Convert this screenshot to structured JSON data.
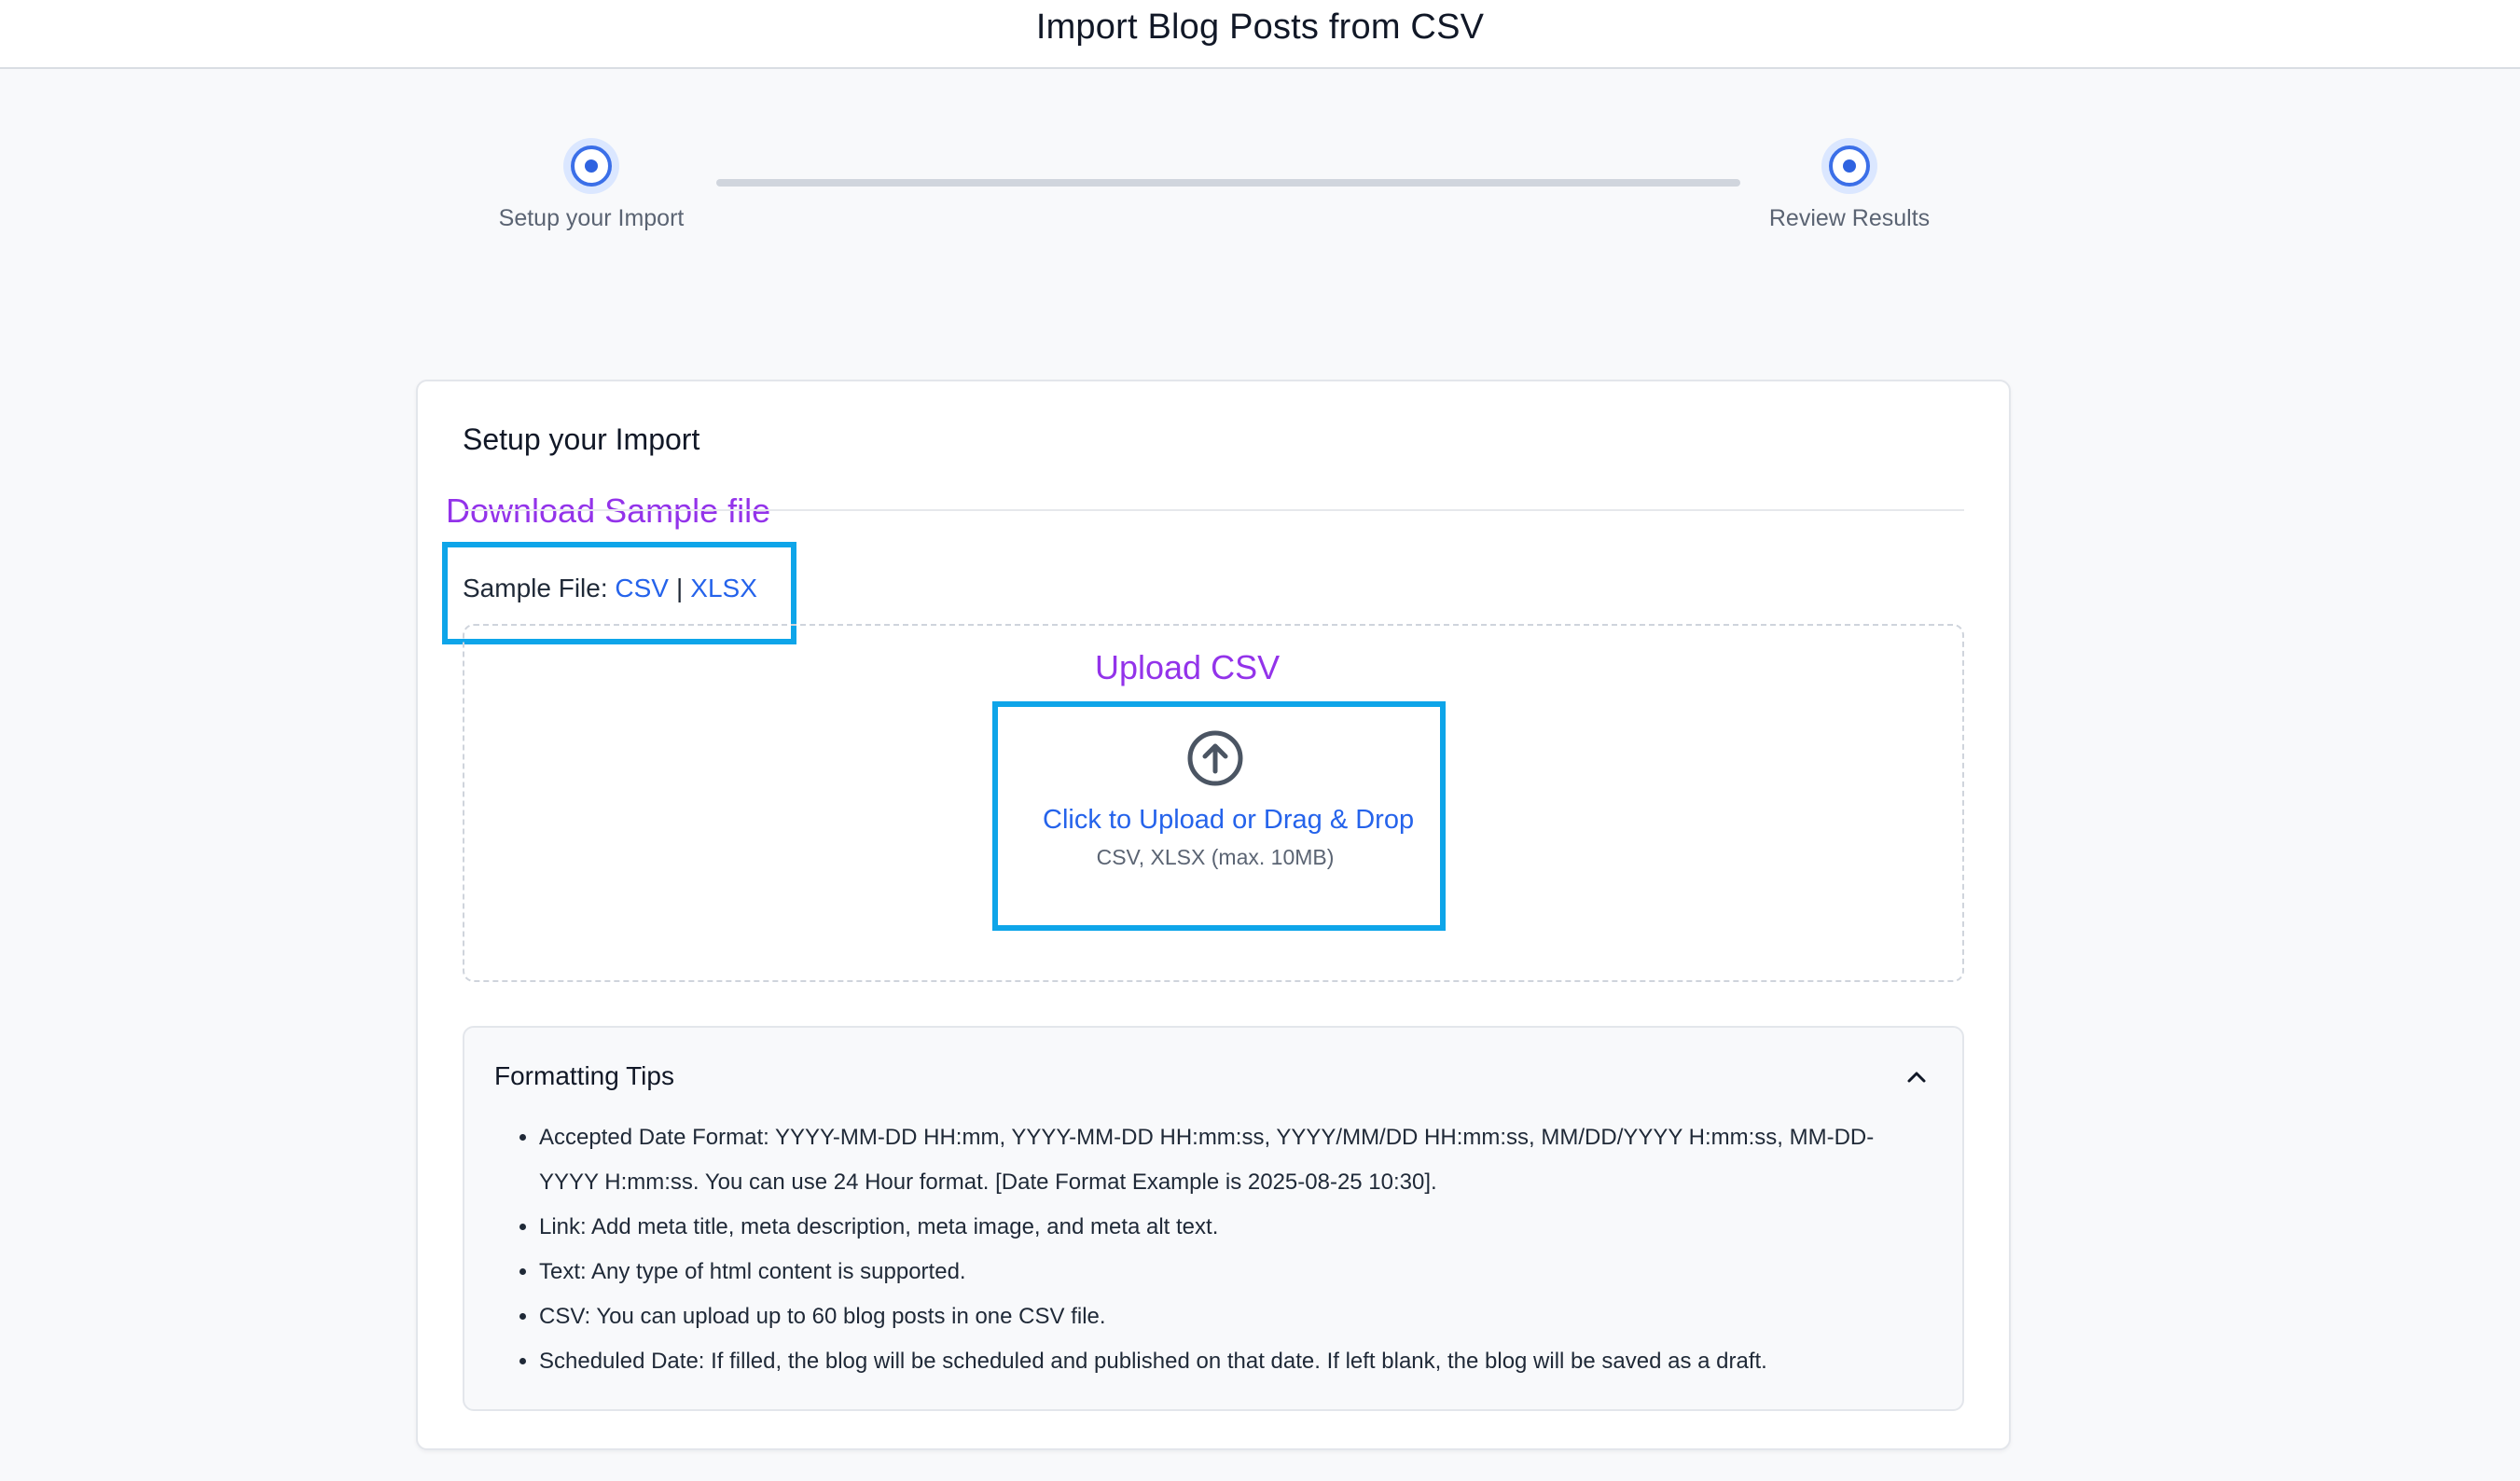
{
  "header": {
    "title": "Import Blog Posts from CSV"
  },
  "stepper": {
    "steps": [
      {
        "label": "Setup your Import"
      },
      {
        "label": "Review Results"
      }
    ]
  },
  "card": {
    "title": "Setup your Import",
    "annotations": {
      "download_sample": "Download Sample file",
      "upload_csv": "Upload CSV"
    },
    "sample": {
      "label": "Sample File:",
      "csv_link": "CSV",
      "separator": "|",
      "xlsx_link": "XLSX"
    },
    "upload": {
      "icon": "upload-arrow-circle-icon",
      "link_text": "Click to Upload or Drag & Drop",
      "hint": "CSV, XLSX (max. 10MB)"
    },
    "tips": {
      "title": "Formatting Tips",
      "expanded": true,
      "items": [
        "Accepted Date Format: YYYY-MM-DD HH:mm, YYYY-MM-DD HH:mm:ss, YYYY/MM/DD HH:mm:ss, MM/DD/YYYY H:mm:ss, MM-DD-YYYY H:mm:ss. You can use 24 Hour format. [Date Format Example is 2025-08-25 10:30].",
        "Link: Add meta title, meta description, meta image, and meta alt text.",
        "Text: Any type of html content is supported.",
        "CSV: You can upload up to 60 blog posts in one CSV file.",
        "Scheduled Date: If filled, the blog will be scheduled and published on that date. If left blank, the blog will be saved as a draft."
      ]
    }
  },
  "colors": {
    "accent": "#2563eb",
    "step_ring": "#3b6fe8",
    "annotation_purple": "#9333ea",
    "annotation_box": "#0ea5e9"
  }
}
